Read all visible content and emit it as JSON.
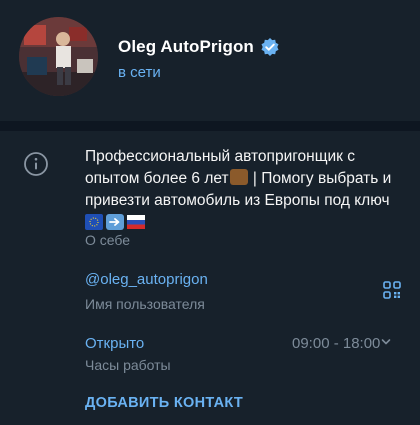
{
  "profile": {
    "name": "Oleg AutoPrigon",
    "status": "в сети",
    "verified": true
  },
  "bio": {
    "line1": "Профессиональный автопригонщик с",
    "line2_start": "опытом более 6 лет",
    "line2_end": " | Помогу выбрать и",
    "line3": "привезти автомобиль из Европы под ключ",
    "emojis": [
      "briefcase",
      "eu-flag",
      "right-arrow",
      "russia-flag"
    ],
    "label": "О себе"
  },
  "username": {
    "value": "@oleg_autoprigon",
    "label": "Имя пользователя"
  },
  "hours": {
    "status": "Открыто",
    "time": "09:00 - 18:00",
    "label": "Часы работы"
  },
  "actions": {
    "add_contact": "ДОБАВИТЬ КОНТАКТ"
  },
  "colors": {
    "background": "#17212b",
    "divider": "#0e1621",
    "accent": "#6ab2f2",
    "secondary_text": "#7d8b99"
  }
}
